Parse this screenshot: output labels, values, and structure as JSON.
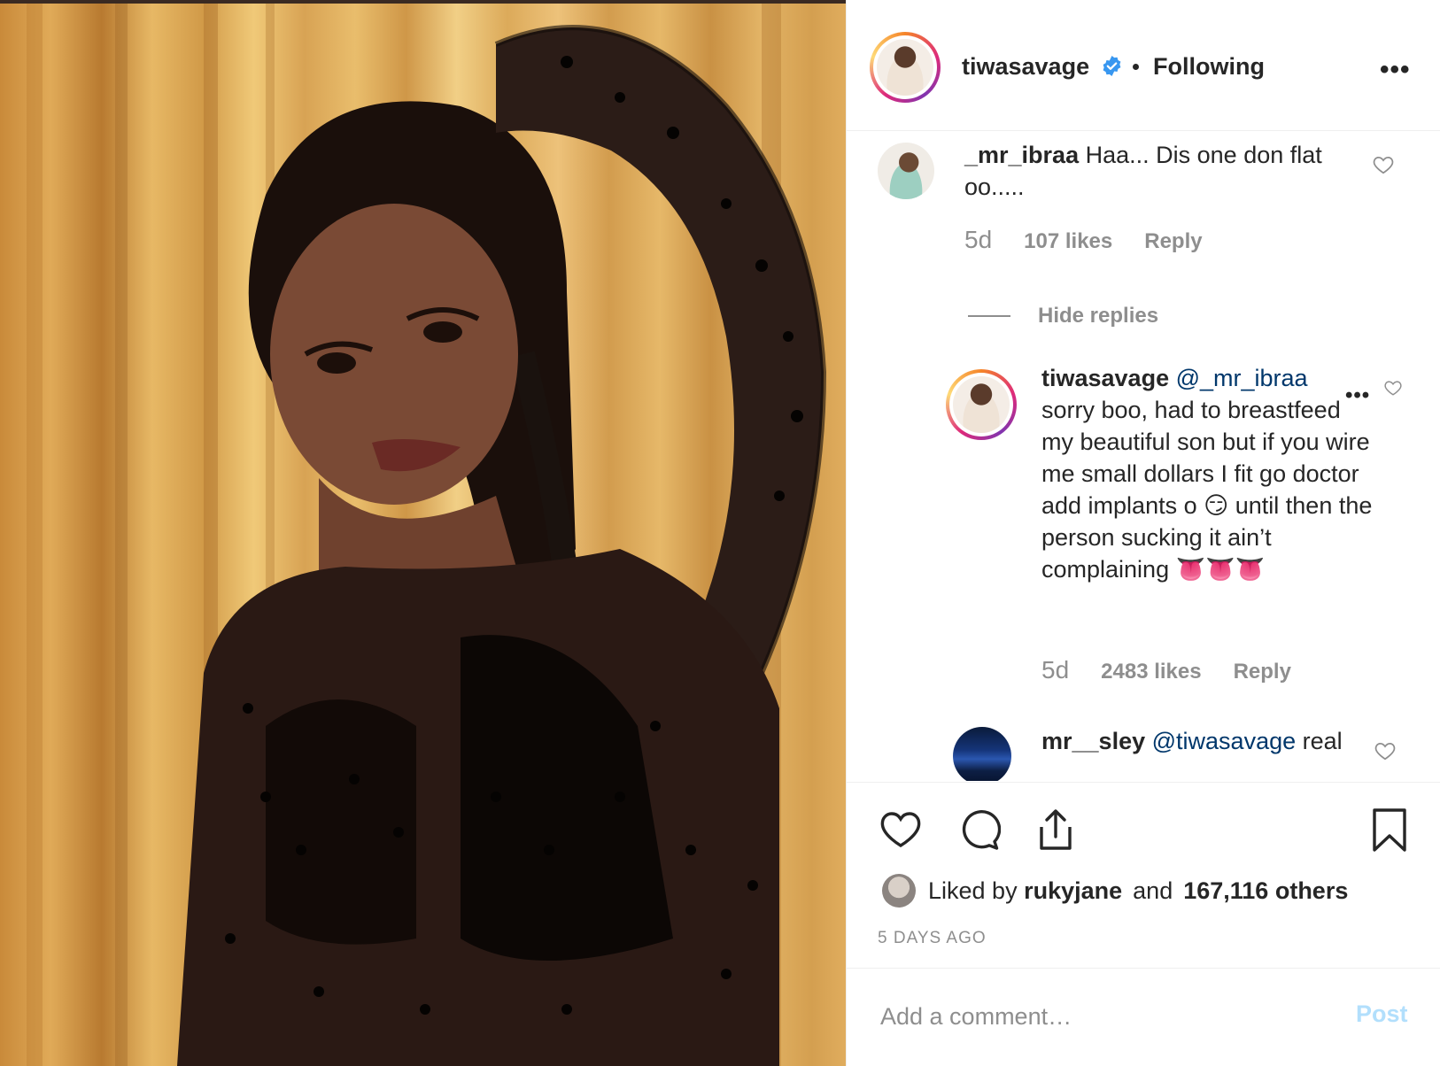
{
  "post": {
    "author": "tiwasavage",
    "follow_status": "Following",
    "more_icon": "more-horizontal-icon",
    "photo_alt": "woman in black mesh top leaning on bamboo wall"
  },
  "comments": [
    {
      "username": "_mr_ibraa",
      "text": "Haa... Dis one don flat oo.....",
      "time": "5d",
      "likes": "107 likes",
      "reply": "Reply"
    }
  ],
  "hide_replies": "Hide replies",
  "replies": [
    {
      "username": "tiwasavage",
      "mention": "@_mr_ibraa",
      "text": "sorry boo, had to breastfeed my beautiful son but if you wire me small dollars I fit go doctor add implants o 😏 until then the person sucking it ain’t complaining 👅👅👅",
      "time": "5d",
      "likes": "2483 likes",
      "reply": "Reply"
    }
  ],
  "comment2": {
    "username": "mr__sley",
    "mention": "@tiwasavage",
    "text": "real"
  },
  "actions": {
    "liked_by_prefix": "Liked by",
    "liked_by_user": "rukyjane",
    "and": "and",
    "others": "167,116 others",
    "timestamp": "5 DAYS AGO"
  },
  "add_comment": {
    "placeholder": "Add a comment…",
    "post_label": "Post"
  },
  "colors": {
    "link": "#00376b",
    "verified": "#3897f0",
    "post_disabled": "#b2dffc",
    "muted": "#8e8e8e"
  }
}
